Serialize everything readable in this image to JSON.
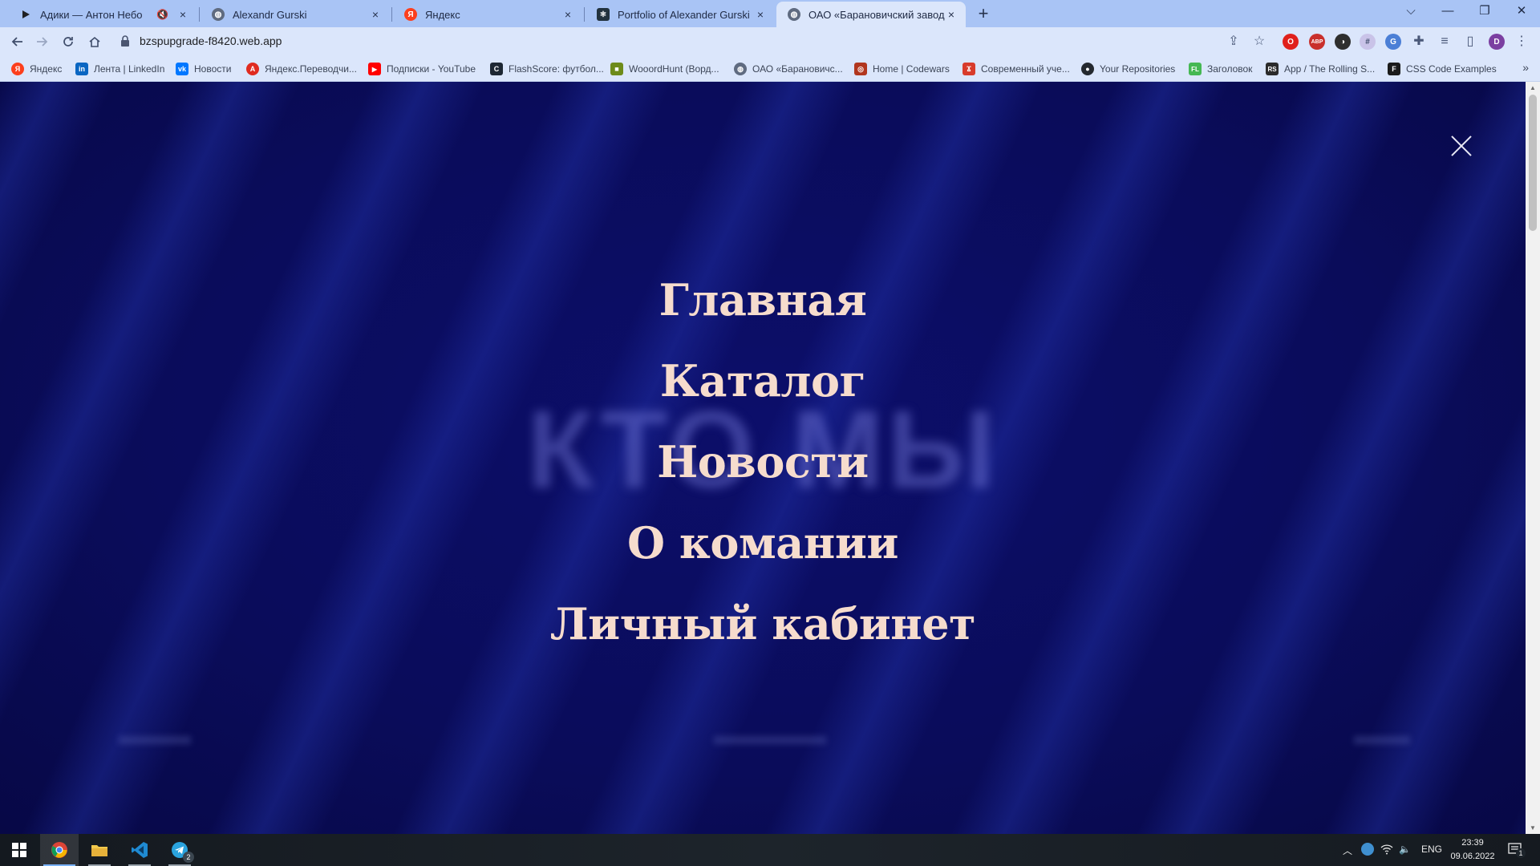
{
  "browser": {
    "tabs": [
      {
        "label": "Адики — Антон Небо",
        "icon": "play-icon",
        "icon_color": "#202124",
        "muted": true,
        "active": false
      },
      {
        "label": "Alexandr Gurski",
        "icon": "globe-icon",
        "icon_color": "#5f6b80",
        "active": false
      },
      {
        "label": "Яндекс",
        "icon": "yandex-icon",
        "icon_color": "#fc3f1d",
        "active": false
      },
      {
        "label": "Portfolio of Alexander Gurski",
        "icon": "react-icon",
        "icon_color": "#22323e",
        "active": false
      },
      {
        "label": "ОАО «Барановичский завод ст",
        "icon": "globe-icon",
        "icon_color": "#5f6b80",
        "active": true
      }
    ],
    "new_tab_symbol": "+",
    "window_controls": {
      "dropdown": "⌵",
      "minimize": "—",
      "restore": "❐",
      "close": "✕"
    },
    "address": "bzspupgrade-f8420.web.app",
    "profile_initial": "D",
    "bookmarks": [
      {
        "label": "Яндекс",
        "icon": "yandex-icon",
        "color": "#fc3f1d",
        "glyph": "Я"
      },
      {
        "label": "Лента | LinkedIn",
        "icon": "linkedin-icon",
        "color": "#0a66c2",
        "glyph": "in"
      },
      {
        "label": "Новости",
        "icon": "vk-icon",
        "color": "#0077ff",
        "glyph": "vk"
      },
      {
        "label": "Яндекс.Переводчи...",
        "icon": "translate-icon",
        "color": "#e02b20",
        "glyph": "A"
      },
      {
        "label": "Подписки - YouTube",
        "icon": "youtube-icon",
        "color": "#ff0000",
        "glyph": "▶"
      },
      {
        "label": "FlashScore: футбол...",
        "icon": "flashscore-icon",
        "color": "#1d2733",
        "glyph": "C"
      },
      {
        "label": "WooordHunt (Ворд...",
        "icon": "wooordhunt-icon",
        "color": "#6d8b1a",
        "glyph": "■"
      },
      {
        "label": "ОАО «Барановичс...",
        "icon": "globe-icon",
        "color": "#5f6b80",
        "glyph": "◍"
      },
      {
        "label": "Home | Codewars",
        "icon": "codewars-icon",
        "color": "#b1361e",
        "glyph": "◎"
      },
      {
        "label": "Современный уче...",
        "icon": "learn-js-icon",
        "color": "#d83b2b",
        "glyph": "Ϫ"
      },
      {
        "label": "Your Repositories",
        "icon": "github-icon",
        "color": "#24292f",
        "glyph": "●"
      },
      {
        "label": "Заголовок",
        "icon": "fl-icon",
        "color": "#45b853",
        "glyph": "FL"
      },
      {
        "label": "App / The Rolling S...",
        "icon": "rs-icon",
        "color": "#2b2b2b",
        "glyph": "RS"
      },
      {
        "label": "CSS Code Examples",
        "icon": "css-examples-icon",
        "color": "#1b1b1b",
        "glyph": "F"
      }
    ],
    "more_bookmarks": "»"
  },
  "page": {
    "background_word": "КТО МЫ",
    "menu": [
      "Главная",
      "Каталог",
      "Новости",
      "О комании",
      "Личный кабинет"
    ],
    "menu_text_color": "#f6dccd",
    "background_color": "#0b0c5e"
  },
  "taskbar": {
    "language": "ENG",
    "time": "23:39",
    "date": "09.06.2022",
    "notification_count": "1",
    "telegram_badge": "2"
  }
}
